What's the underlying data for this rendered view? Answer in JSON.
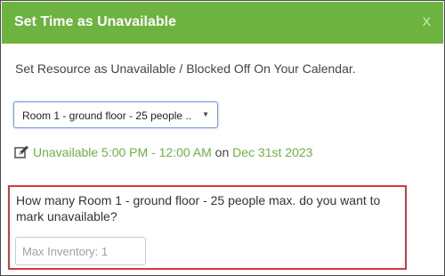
{
  "modal": {
    "title": "Set Time as Unavailable",
    "close_label": "X",
    "subtitle": "Set Resource as Unavailable / Blocked Off On Your Calendar.",
    "accent_color": "#6db33f",
    "highlight_color": "#d9363e"
  },
  "resource_select": {
    "selected_value": "Room 1 - ground floor - 25 people ...",
    "caret_icon": "triangle-down-icon"
  },
  "status": {
    "icon": "edit-icon",
    "unavailable_text": "Unavailable 5:00 PM - 12:00 AM",
    "connector": "on",
    "date": "Dec 31st 2023"
  },
  "quantity": {
    "question": "How many Room 1 - ground floor - 25 people max. do you want to mark unavailable?",
    "input_placeholder": "Max Inventory: 1",
    "input_value": ""
  }
}
